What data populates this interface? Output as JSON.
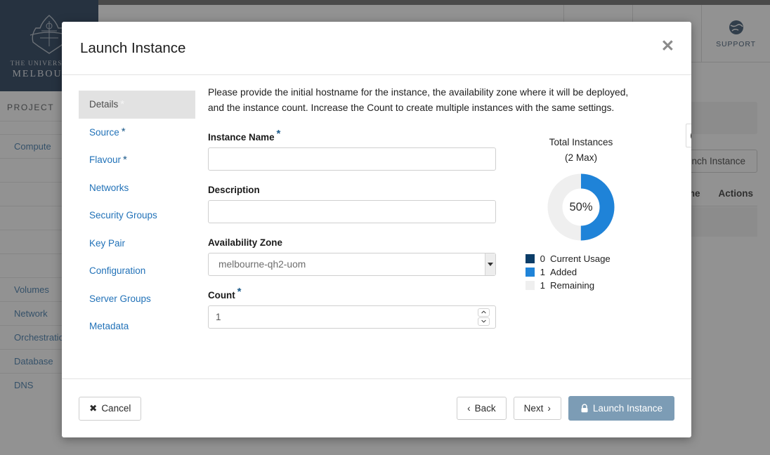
{
  "background": {
    "brand": {
      "line1": "THE UNIVERSITY OF",
      "line2": "MELBOURNE",
      "crest_icon": "university-crest-icon"
    },
    "header": {
      "items": [
        {
          "label": "",
          "icon": "project-icon"
        },
        {
          "label": "",
          "icon": "user-icon"
        },
        {
          "label": "SUPPORT",
          "icon": "globe-icon"
        }
      ]
    },
    "sidebar": {
      "section_label": "PROJECT",
      "items": [
        {
          "label": "",
          "caret": false
        },
        {
          "label": "Compute",
          "caret": false
        },
        {
          "label": "",
          "caret": false
        },
        {
          "label": "",
          "caret": false
        },
        {
          "label": "",
          "caret": false
        },
        {
          "label": "",
          "caret": false
        },
        {
          "label": "",
          "caret": false
        },
        {
          "label": "Volumes",
          "caret": false
        },
        {
          "label": "Network",
          "caret": false
        },
        {
          "label": "Orchestration",
          "caret": false
        },
        {
          "label": "Database",
          "caret": false
        },
        {
          "label": "DNS",
          "caret": true
        }
      ]
    },
    "main": {
      "launch_button": "Launch Instance",
      "table_headers": [
        "Time",
        "Actions"
      ]
    }
  },
  "modal": {
    "title": "Launch Instance",
    "close_icon": "close-icon",
    "help_icon": "help-icon",
    "help_glyph": "?",
    "wizard_steps": [
      {
        "label": "Details",
        "required": true,
        "active": true
      },
      {
        "label": "Source",
        "required": true,
        "active": false
      },
      {
        "label": "Flavour",
        "required": true,
        "active": false
      },
      {
        "label": "Networks",
        "required": false,
        "active": false
      },
      {
        "label": "Security Groups",
        "required": false,
        "active": false
      },
      {
        "label": "Key Pair",
        "required": false,
        "active": false
      },
      {
        "label": "Configuration",
        "required": false,
        "active": false
      },
      {
        "label": "Server Groups",
        "required": false,
        "active": false
      },
      {
        "label": "Metadata",
        "required": false,
        "active": false
      }
    ],
    "intro_text": "Please provide the initial hostname for the instance, the availability zone where it will be deployed, and the instance count. Increase the Count to create multiple instances with the same settings.",
    "fields": {
      "instance_name": {
        "label": "Instance Name",
        "required": true,
        "value": "",
        "placeholder": ""
      },
      "description": {
        "label": "Description",
        "required": false,
        "value": "",
        "placeholder": ""
      },
      "availability_zone": {
        "label": "Availability Zone",
        "required": false,
        "selected": "melbourne-qh2-uom",
        "options": [
          "melbourne-qh2-uom"
        ]
      },
      "count": {
        "label": "Count",
        "required": true,
        "value": "1",
        "placeholder": "1"
      }
    },
    "quota": {
      "title": "Total Instances",
      "subtitle": "(2 Max)",
      "percent_label": "50%",
      "legend": [
        {
          "count": "0",
          "label": "Current Usage",
          "color": "#0b3d68"
        },
        {
          "count": "1",
          "label": "Added",
          "color": "#1f83d8"
        },
        {
          "count": "1",
          "label": "Remaining",
          "color": "#efefef"
        }
      ]
    },
    "footer": {
      "cancel": "Cancel",
      "back": "Back",
      "next": "Next",
      "launch": "Launch Instance"
    }
  },
  "chart_data": {
    "type": "pie",
    "title": "Total Instances (2 Max)",
    "categories": [
      "Current Usage",
      "Added",
      "Remaining"
    ],
    "values": [
      0,
      1,
      1
    ],
    "colors": [
      "#0b3d68",
      "#1f83d8",
      "#efefef"
    ],
    "center_label": "50%",
    "legend": "bottom-left",
    "max": 2
  }
}
